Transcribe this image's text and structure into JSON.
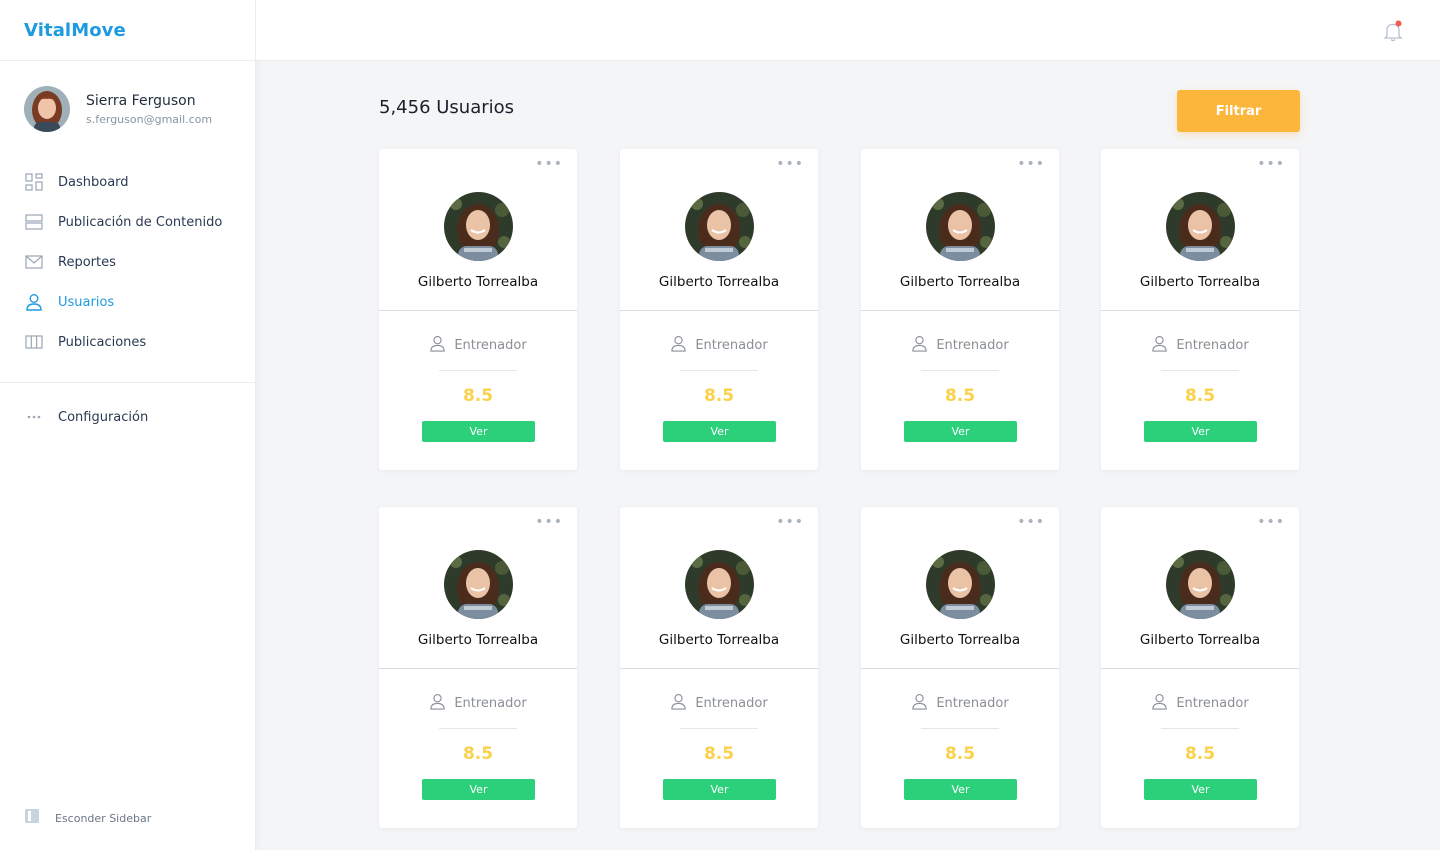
{
  "app": {
    "brand": "VitalMove"
  },
  "user": {
    "name": "Sierra Ferguson",
    "email": "s.ferguson@gmail.com"
  },
  "sidebar": {
    "items": [
      {
        "label": "Dashboard",
        "icon": "dashboard-grid-icon",
        "active": false
      },
      {
        "label": "Publicación de Contenido",
        "icon": "content-stack-icon",
        "active": false
      },
      {
        "label": "Reportes",
        "icon": "mail-icon",
        "active": false
      },
      {
        "label": "Usuarios",
        "icon": "user-icon",
        "active": true
      },
      {
        "label": "Publicaciones",
        "icon": "columns-icon",
        "active": false
      }
    ],
    "config_label": "Configuración",
    "hide_label": "Esconder Sidebar"
  },
  "main": {
    "count_label": "5,456 Usuarios",
    "filter_label": "Filtrar"
  },
  "cards": [
    {
      "name": "Gilberto Torrealba",
      "role": "Entrenador",
      "score": "8.5",
      "button": "Ver"
    },
    {
      "name": "Gilberto Torrealba",
      "role": "Entrenador",
      "score": "8.5",
      "button": "Ver"
    },
    {
      "name": "Gilberto Torrealba",
      "role": "Entrenador",
      "score": "8.5",
      "button": "Ver"
    },
    {
      "name": "Gilberto Torrealba",
      "role": "Entrenador",
      "score": "8.5",
      "button": "Ver"
    },
    {
      "name": "Gilberto Torrealba",
      "role": "Entrenador",
      "score": "8.5",
      "button": "Ver"
    },
    {
      "name": "Gilberto Torrealba",
      "role": "Entrenador",
      "score": "8.5",
      "button": "Ver"
    },
    {
      "name": "Gilberto Torrealba",
      "role": "Entrenador",
      "score": "8.5",
      "button": "Ver"
    },
    {
      "name": "Gilberto Torrealba",
      "role": "Entrenador",
      "score": "8.5",
      "button": "Ver"
    }
  ],
  "colors": {
    "brand": "#1e9be0",
    "filter": "#fdb63c",
    "score": "#fbd14a",
    "view_button": "#2cd07a",
    "notification_dot": "#f25c54"
  }
}
